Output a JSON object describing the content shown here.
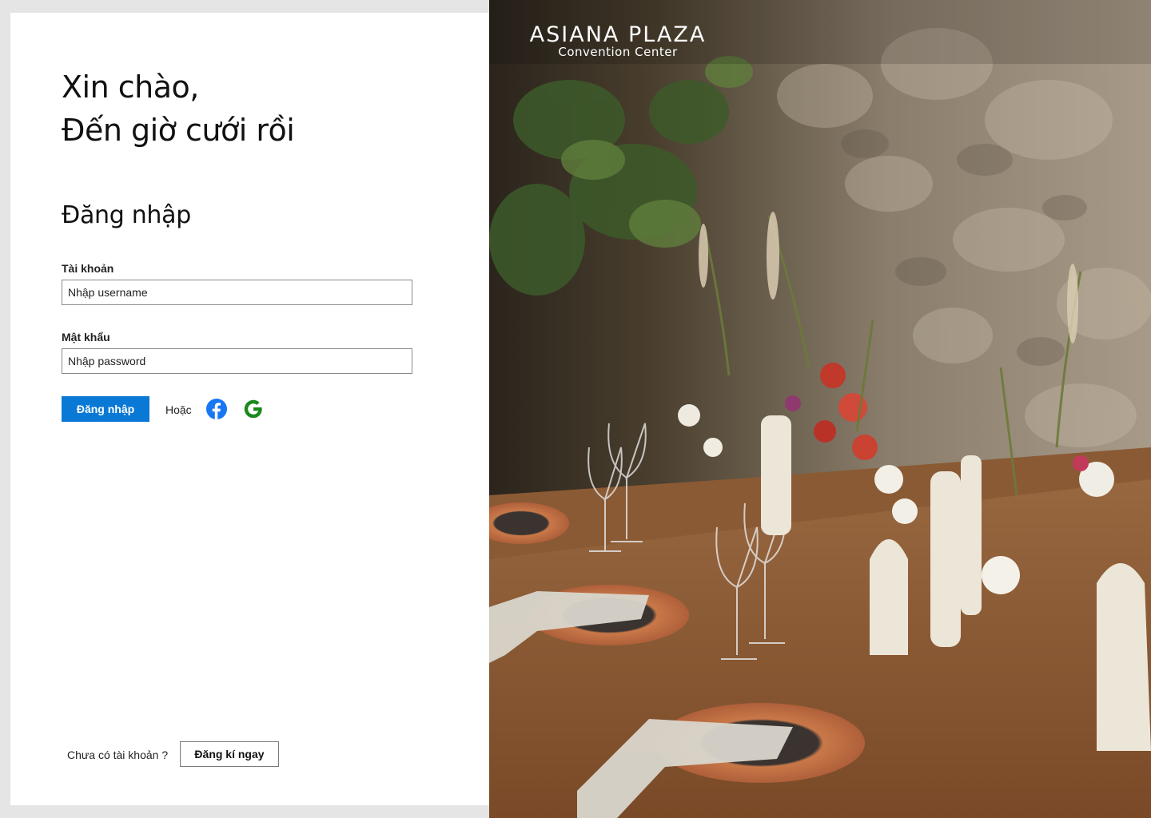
{
  "greeting": {
    "line1": "Xin chào,",
    "line2": "Đến giờ cưới rồi"
  },
  "login": {
    "heading": "Đăng nhập",
    "username_label": "Tài khoản",
    "username_placeholder": "Nhập username",
    "password_label": "Mật khẩu",
    "password_placeholder": "Nhập password",
    "submit_label": "Đăng nhập",
    "or_label": "Hoặc",
    "social_icons": [
      "facebook-icon",
      "google-icon"
    ]
  },
  "signup": {
    "prompt": "Chưa có tài khoản ?",
    "button_label": "Đăng kí ngay"
  },
  "brand": {
    "name": "ASIANA PLAZA",
    "subtitle": "Convention Center"
  },
  "colors": {
    "primary": "#0a78d5",
    "facebook": "#1877f2",
    "google": "#1a8a1a",
    "page_bg": "#e5e5e5"
  }
}
